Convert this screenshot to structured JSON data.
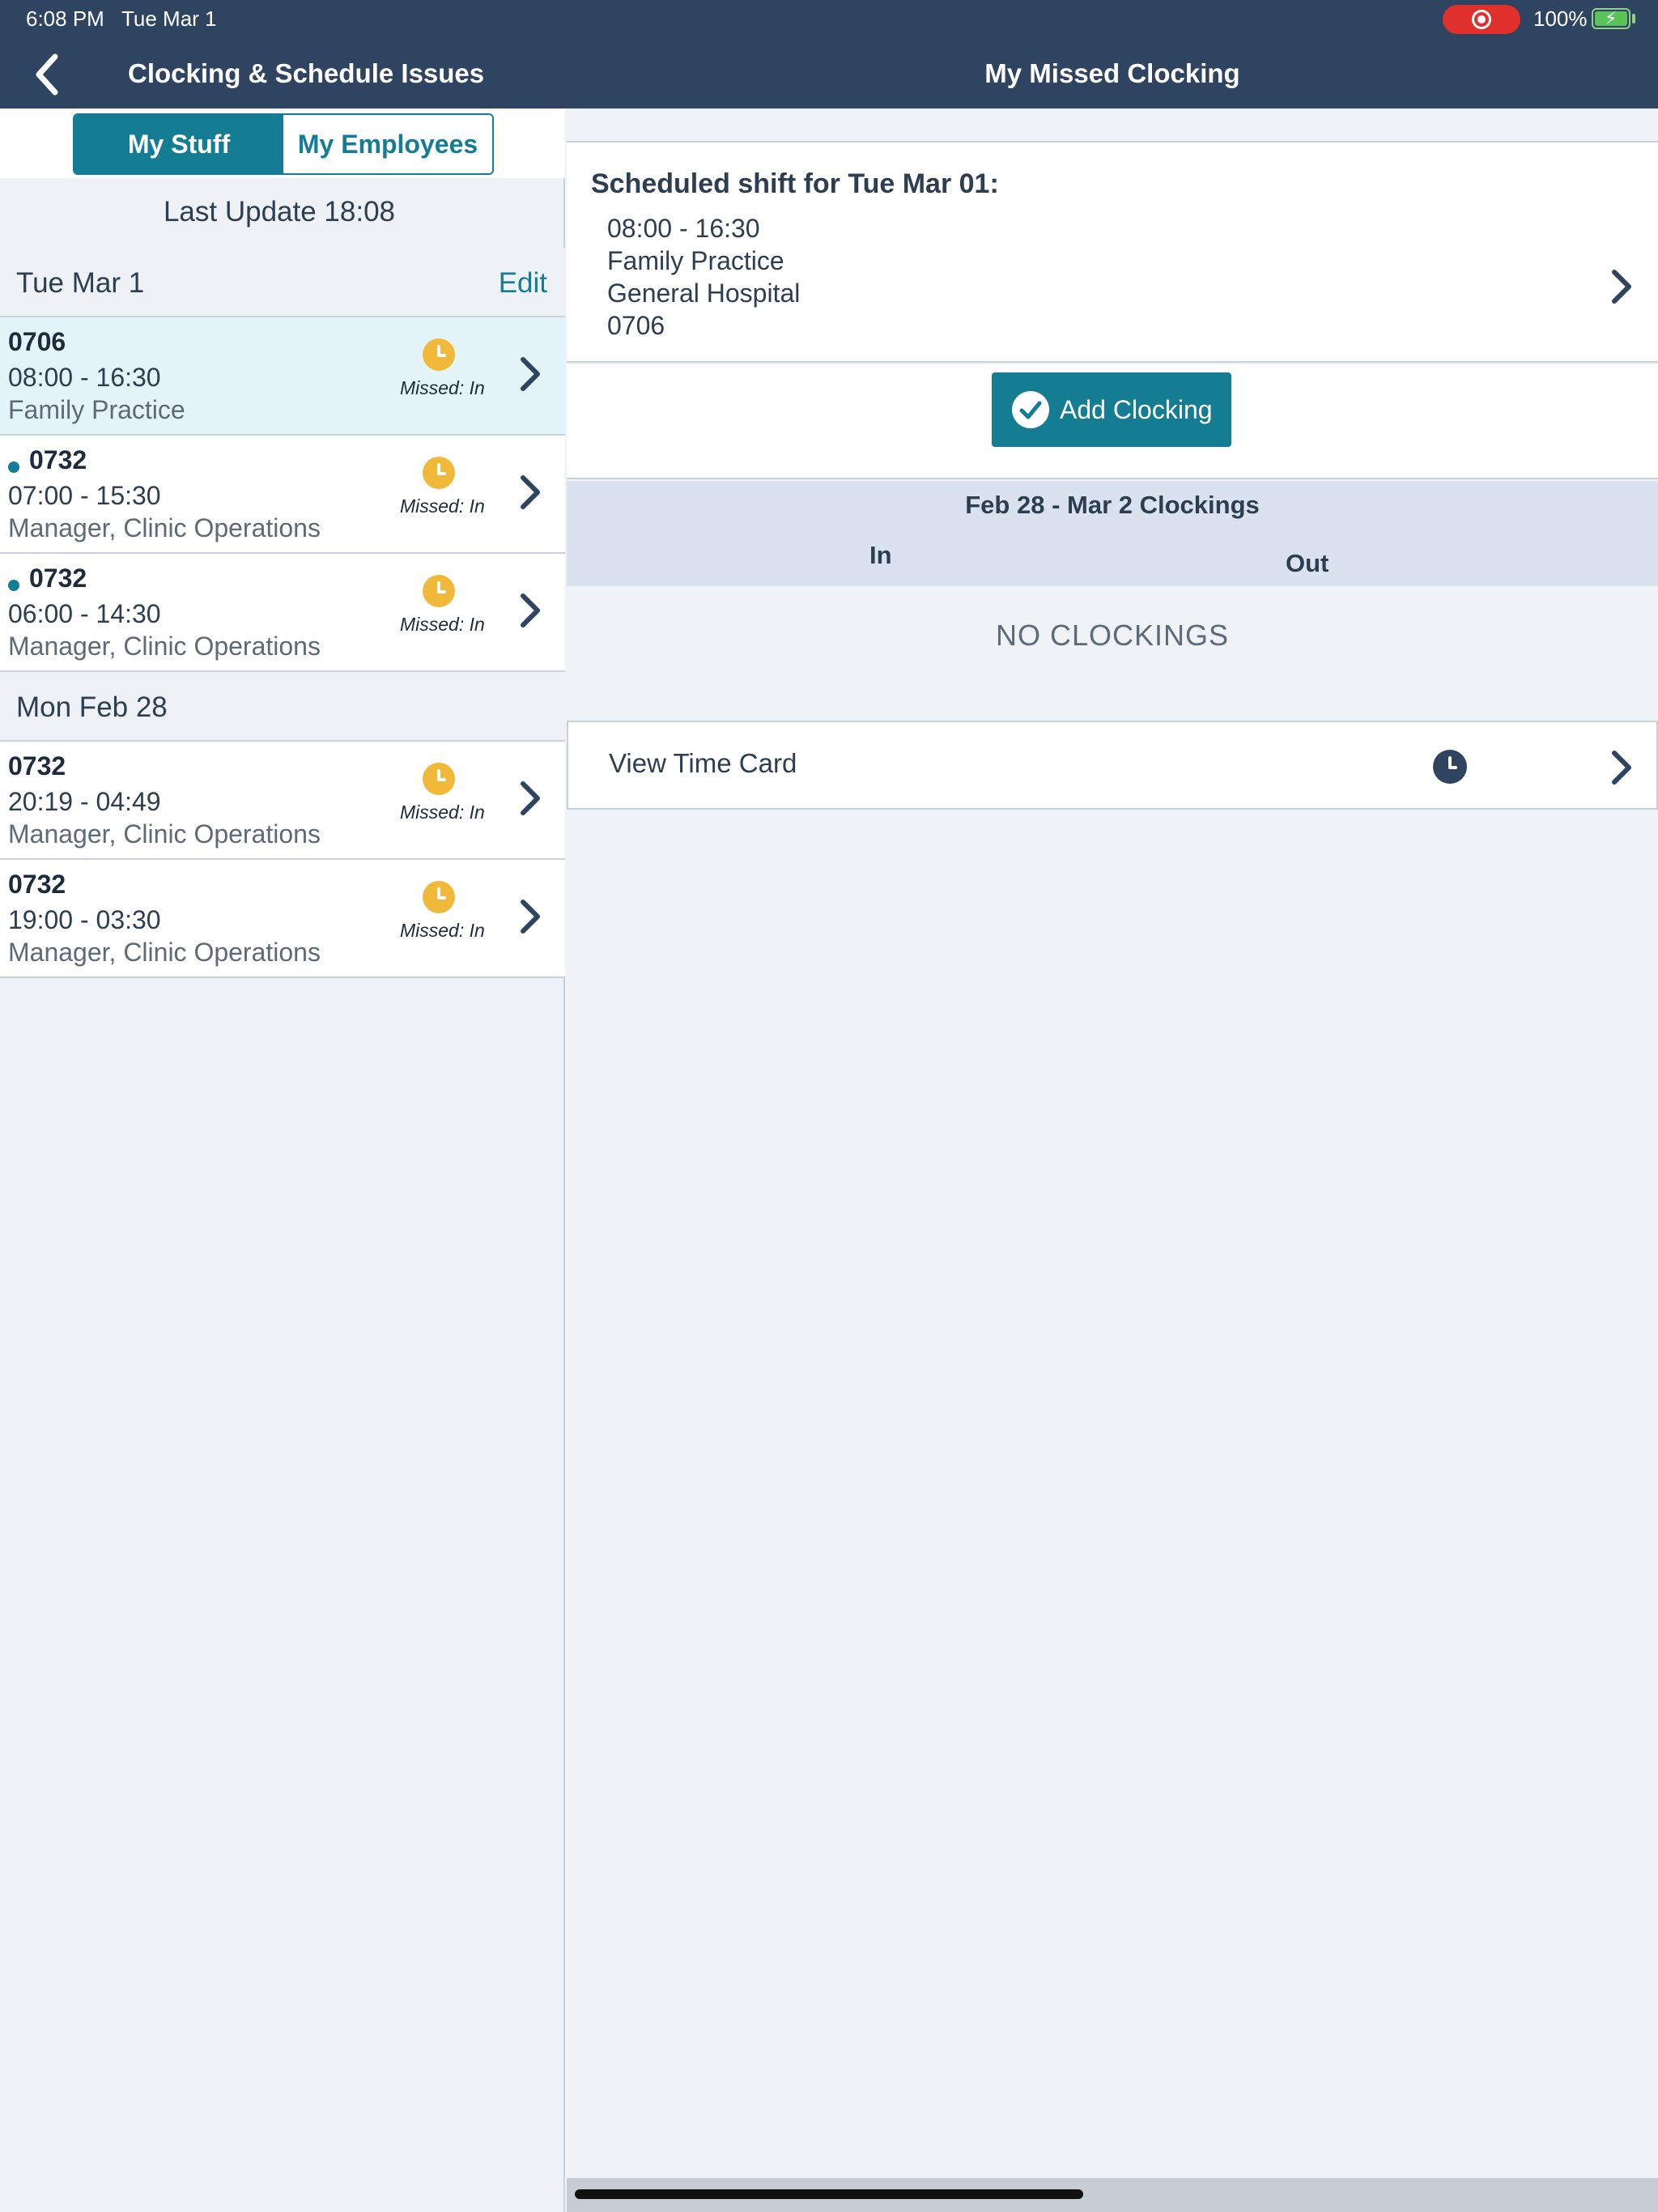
{
  "status_bar": {
    "time": "6:08 PM",
    "date": "Tue Mar 1",
    "battery": "100%"
  },
  "nav": {
    "left_title": "Clocking & Schedule Issues",
    "right_title": "My Missed Clocking"
  },
  "segments": {
    "my_stuff": "My Stuff",
    "my_employees": "My Employees",
    "selected": "My Stuff"
  },
  "last_update": "Last Update 18:08",
  "groups": [
    {
      "label": "Tue Mar 1",
      "edit": "Edit"
    },
    {
      "label": "Mon Feb 28"
    }
  ],
  "items": [
    {
      "code": "0706",
      "time": "08:00 - 16:30",
      "role": "Family Practice",
      "status": "Missed: In"
    },
    {
      "code": "0732",
      "time": "07:00 - 15:30",
      "role": "Manager, Clinic Operations",
      "status": "Missed: In"
    },
    {
      "code": "0732",
      "time": "06:00 - 14:30",
      "role": "Manager, Clinic Operations",
      "status": "Missed: In"
    },
    {
      "code": "0732",
      "time": "20:19 - 04:49",
      "role": "Manager, Clinic Operations",
      "status": "Missed: In"
    },
    {
      "code": "0732",
      "time": "19:00 - 03:30",
      "role": "Manager, Clinic Operations",
      "status": "Missed: In"
    }
  ],
  "detail": {
    "heading": "Scheduled shift for Tue Mar 01:",
    "time": "08:00 - 16:30",
    "department": "Family Practice",
    "location": "General Hospital",
    "code": "0706",
    "add_button": "Add Clocking",
    "clockings_title": "Feb 28 - Mar 2 Clockings",
    "col_in": "In",
    "col_out": "Out",
    "empty": "NO CLOCKINGS",
    "time_card": "View Time Card"
  },
  "colors": {
    "nav_bg": "#2e4460",
    "accent": "#157d93",
    "warning": "#f0b93a",
    "selected_row": "#e4f5fa"
  }
}
